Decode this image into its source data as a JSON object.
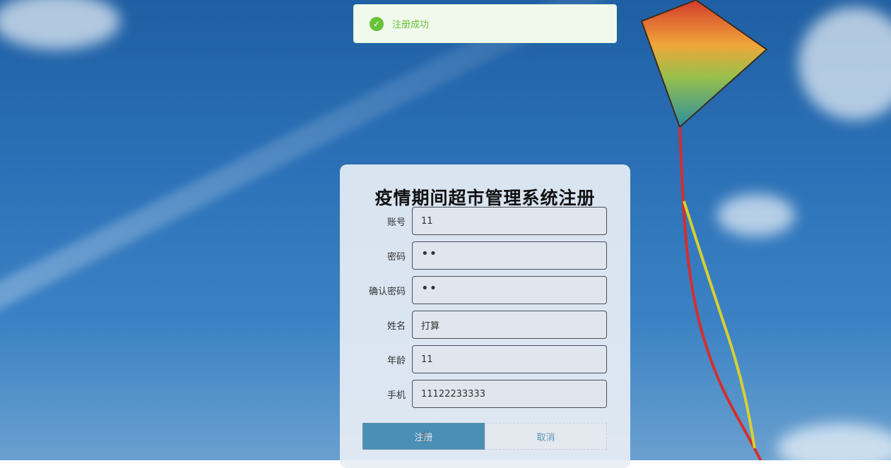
{
  "toast": {
    "icon": "check-circle-icon",
    "message": "注册成功",
    "color": "#67c23a"
  },
  "form": {
    "title": "疫情期间超市管理系统注册",
    "fields": [
      {
        "label": "账号",
        "value": "11"
      },
      {
        "label": "密码",
        "value": "••"
      },
      {
        "label": "确认密码",
        "value": "••"
      },
      {
        "label": "姓名",
        "value": "打算"
      },
      {
        "label": "年龄",
        "value": "11"
      },
      {
        "label": "手机",
        "value": "11122233333"
      }
    ],
    "submit_label": "注册",
    "cancel_label": "取消"
  },
  "colors": {
    "submit_bg": "#4a8fb6",
    "cancel_text": "#5f95b8"
  }
}
